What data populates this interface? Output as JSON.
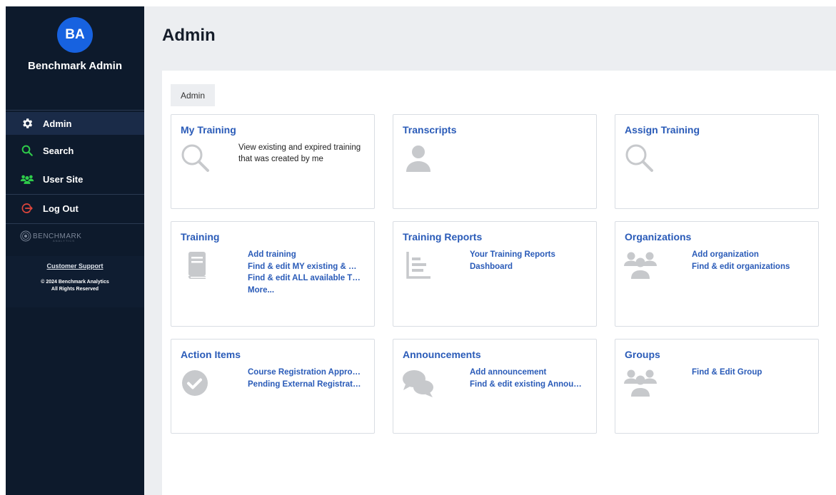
{
  "sidebar": {
    "avatar_initials": "BA",
    "user_name": "Benchmark Admin",
    "items": [
      {
        "label": "Admin",
        "icon": "gear-icon",
        "active": true
      },
      {
        "label": "Search",
        "icon": "search-icon",
        "active": false
      },
      {
        "label": "User Site",
        "icon": "users-icon",
        "active": false
      },
      {
        "label": "Log Out",
        "icon": "logout-icon",
        "active": false
      }
    ],
    "brand_logo": "BENCHMARK",
    "brand_sub": "ANALYTICS",
    "support_link": "Customer Support",
    "copyright_line1": "© 2024 Benchmark Analytics",
    "copyright_line2": "All Rights Reserved"
  },
  "colors": {
    "sidebar_bg": "#0d1a2c",
    "avatar_bg": "#1762e0",
    "link": "#2a5bb8",
    "search_icon": "#2ecc4a",
    "users_icon": "#2ecc4a",
    "logout_icon": "#e0463c",
    "placeholder_icon": "#c7c9cc"
  },
  "main": {
    "page_title": "Admin",
    "breadcrumb": "Admin",
    "cards": [
      {
        "title": "My Training",
        "icon": "magnifier-icon",
        "description": "View existing and expired training that was created by me",
        "links": []
      },
      {
        "title": "Transcripts",
        "icon": "person-icon",
        "description": "",
        "links": []
      },
      {
        "title": "Assign Training",
        "icon": "magnifier-icon",
        "description": "",
        "links": []
      },
      {
        "title": "Training",
        "icon": "book-icon",
        "description": "",
        "links": [
          "Add training",
          "Find & edit MY existing & …",
          "Find & edit ALL available T…",
          "More..."
        ]
      },
      {
        "title": "Training Reports",
        "icon": "report-icon",
        "description": "",
        "links": [
          "Your Training Reports",
          "Dashboard"
        ]
      },
      {
        "title": "Organizations",
        "icon": "group-icon",
        "description": "",
        "links": [
          "Add organization",
          "Find & edit organizations"
        ]
      },
      {
        "title": "Action Items",
        "icon": "checkmark-icon",
        "description": "",
        "links": [
          "Course Registration Appro…",
          "Pending External Registrat…"
        ]
      },
      {
        "title": "Announcements",
        "icon": "chat-bubbles-icon",
        "description": "",
        "links": [
          "Add announcement",
          "Find & edit existing Annou…"
        ]
      },
      {
        "title": "Groups",
        "icon": "group-icon",
        "description": "",
        "links": [
          "Find & Edit Group"
        ]
      }
    ]
  }
}
